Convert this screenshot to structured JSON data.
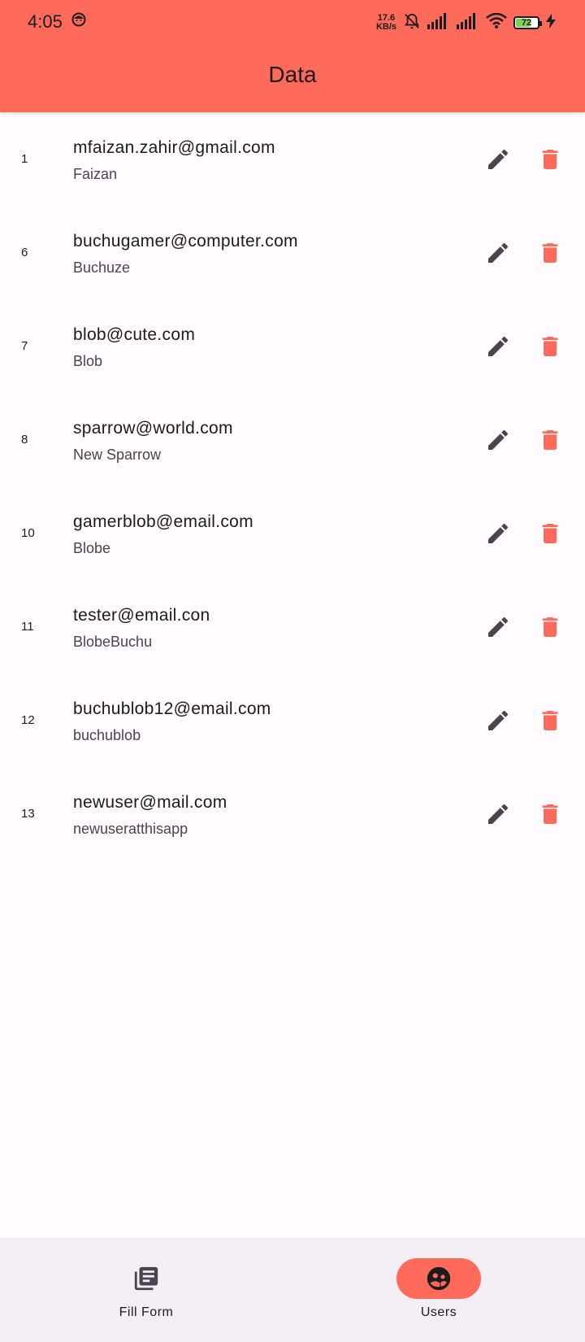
{
  "status_bar": {
    "time": "4:05",
    "net_speed_value": "17.6",
    "net_speed_unit": "KB/s",
    "battery_level": 72,
    "battery_text": "72",
    "icons": [
      "face-icon",
      "bell-off-icon",
      "signal-icon",
      "signal-icon",
      "wifi-icon",
      "battery-icon",
      "charging-icon"
    ]
  },
  "app_bar": {
    "title": "Data"
  },
  "users": [
    {
      "id": "1",
      "email": "mfaizan.zahir@gmail.com",
      "name": "Faizan"
    },
    {
      "id": "6",
      "email": "buchugamer@computer.com",
      "name": "Buchuze"
    },
    {
      "id": "7",
      "email": "blob@cute.com",
      "name": "Blob"
    },
    {
      "id": "8",
      "email": "sparrow@world.com",
      "name": "New Sparrow"
    },
    {
      "id": "10",
      "email": "gamerblob@email.com",
      "name": "Blobe"
    },
    {
      "id": "11",
      "email": "tester@email.con",
      "name": "BlobeBuchu"
    },
    {
      "id": "12",
      "email": "buchublob12@email.com",
      "name": "buchublob"
    },
    {
      "id": "13",
      "email": "newuser@mail.com",
      "name": "newuseratthisapp"
    }
  ],
  "bottom_nav": {
    "items": [
      {
        "label": "Fill Form",
        "icon": "article-icon",
        "active": false
      },
      {
        "label": "Users",
        "icon": "users-icon",
        "active": true
      }
    ]
  },
  "colors": {
    "primary": "#ff6a5b",
    "edit_icon": "#49454f",
    "delete_icon": "#ff6a5b",
    "background": "#fffbfe",
    "nav_background": "#f3edf4"
  }
}
